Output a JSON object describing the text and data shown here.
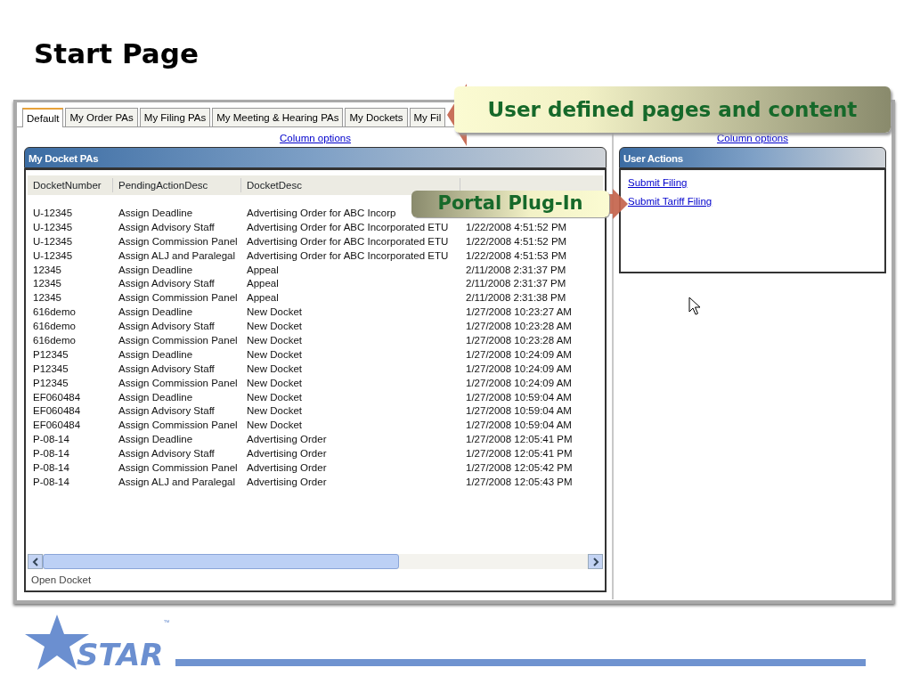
{
  "title": "Start Page",
  "tabs": [
    {
      "label": "Default",
      "selected": true
    },
    {
      "label": "My Order PAs",
      "selected": false
    },
    {
      "label": "My Filing PAs",
      "selected": false
    },
    {
      "label": "My Meeting & Hearing PAs",
      "selected": false
    },
    {
      "label": "My Dockets",
      "selected": false
    },
    {
      "label": "My Fil",
      "selected": false
    }
  ],
  "left_pane": {
    "column_options": "Column options",
    "panel_title": "My Docket PAs",
    "columns": [
      "DocketNumber",
      "PendingActionDesc",
      "DocketDesc"
    ],
    "rows": [
      [
        "U-12345",
        "Assign Deadline",
        "Advertising Order for ABC Incorp"
      ],
      [
        "U-12345",
        "Assign Advisory Staff",
        "Advertising Order for ABC Incorporated ETU",
        "1/22/2008 4:51:52 PM"
      ],
      [
        "U-12345",
        "Assign Commission Panel",
        "Advertising Order for ABC Incorporated ETU",
        "1/22/2008 4:51:52 PM"
      ],
      [
        "U-12345",
        "Assign ALJ and Paralegal",
        "Advertising Order for ABC Incorporated ETU",
        "1/22/2008 4:51:53 PM"
      ],
      [
        "12345",
        "Assign Deadline",
        "Appeal",
        "2/11/2008 2:31:37 PM"
      ],
      [
        "12345",
        "Assign Advisory Staff",
        "Appeal",
        "2/11/2008 2:31:37 PM"
      ],
      [
        "12345",
        "Assign Commission Panel",
        "Appeal",
        "2/11/2008 2:31:38 PM"
      ],
      [
        "616demo",
        "Assign Deadline",
        "New Docket",
        "1/27/2008 10:23:27 AM"
      ],
      [
        "616demo",
        "Assign Advisory Staff",
        "New Docket",
        "1/27/2008 10:23:28 AM"
      ],
      [
        "616demo",
        "Assign Commission Panel",
        "New Docket",
        "1/27/2008 10:23:28 AM"
      ],
      [
        "P12345",
        "Assign Deadline",
        "New Docket",
        "1/27/2008 10:24:09 AM"
      ],
      [
        "P12345",
        "Assign Advisory Staff",
        "New Docket",
        "1/27/2008 10:24:09 AM"
      ],
      [
        "P12345",
        "Assign Commission Panel",
        "New Docket",
        "1/27/2008 10:24:09 AM"
      ],
      [
        "EF060484",
        "Assign Deadline",
        "New Docket",
        "1/27/2008 10:59:04 AM"
      ],
      [
        "EF060484",
        "Assign Advisory Staff",
        "New Docket",
        "1/27/2008 10:59:04 AM"
      ],
      [
        "EF060484",
        "Assign Commission Panel",
        "New Docket",
        "1/27/2008 10:59:04 AM"
      ],
      [
        "P-08-14",
        "Assign Deadline",
        "Advertising Order",
        "1/27/2008 12:05:41 PM"
      ],
      [
        "P-08-14",
        "Assign Advisory Staff",
        "Advertising Order",
        "1/27/2008 12:05:41 PM"
      ],
      [
        "P-08-14",
        "Assign Commission Panel",
        "Advertising Order",
        "1/27/2008 12:05:42 PM"
      ],
      [
        "P-08-14",
        "Assign ALJ and Paralegal",
        "Advertising Order",
        "1/27/2008 12:05:43 PM"
      ]
    ],
    "status": "Open Docket"
  },
  "right_pane": {
    "column_options": "Column options",
    "panel_title": "User Actions",
    "links": [
      "Submit Filing",
      "Submit Tariff Filing"
    ]
  },
  "callouts": [
    {
      "text": "User defined pages and content",
      "kind": "left"
    },
    {
      "text": "Portal Plug-In",
      "kind": "right"
    }
  ],
  "logo": {
    "text": "STAR",
    "mark": "™"
  }
}
